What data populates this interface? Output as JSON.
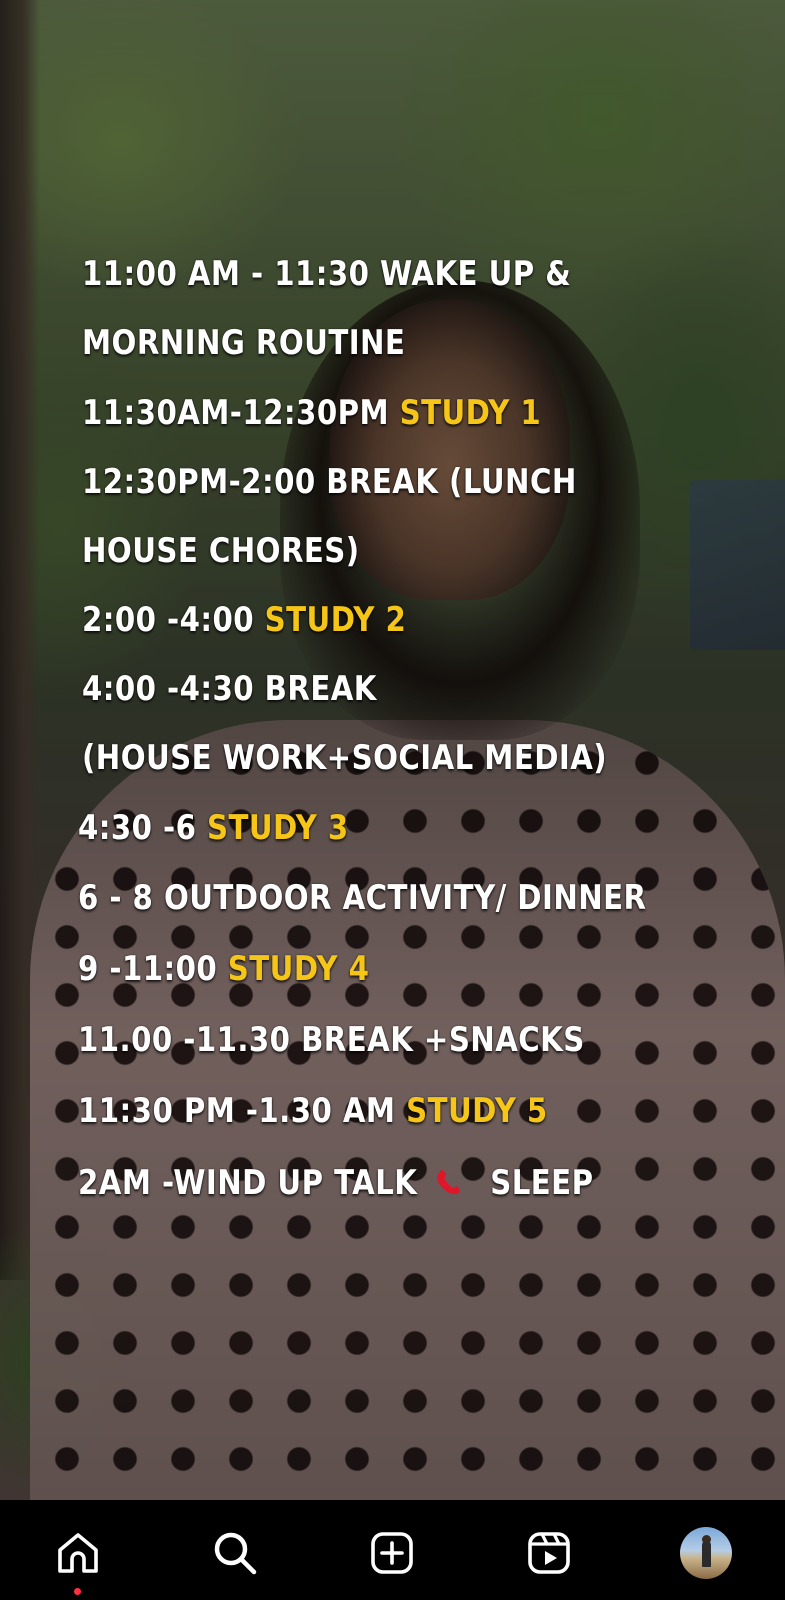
{
  "schedule": {
    "lines": [
      {
        "text": "11:00 AM - 11:30  WAKE UP &",
        "highlight": ""
      },
      {
        "text": "MORNING ROUTINE",
        "highlight": ""
      },
      {
        "text": "11:30AM-12:30PM ",
        "highlight": "STUDY 1"
      },
      {
        "text": "12:30PM-2:00 BREAK (LUNCH",
        "highlight": ""
      },
      {
        "text": "HOUSE CHORES)",
        "highlight": ""
      },
      {
        "text": "2:00 -4:00  ",
        "highlight": "STUDY 2"
      },
      {
        "text": "4:00 -4:30  BREAK",
        "highlight": ""
      },
      {
        "text": "(HOUSE WORK+SOCIAL MEDIA)",
        "highlight": ""
      },
      {
        "text": "4:30 -6  ",
        "highlight": "STUDY 3"
      },
      {
        "text": "6 - 8  OUTDOOR ACTIVITY/ DINNER",
        "highlight": ""
      },
      {
        "text": "9 -11:00  ",
        "highlight": "STUDY 4"
      },
      {
        "text": "11.00 -11.30 BREAK +SNACKS",
        "highlight": ""
      },
      {
        "text": "11:30 PM -1.30 AM ",
        "highlight": "STUDY 5"
      },
      {
        "text_before": "2AM -WIND UP TALK",
        "emoji": "telephone-receiver-icon",
        "text_after": "SLEEP"
      }
    ]
  },
  "colors": {
    "text": "#ffffff",
    "highlight": "#f5c518",
    "nav_background": "#000000",
    "notification_dot": "#ff3040"
  },
  "bottom_nav": {
    "items": [
      {
        "name": "home",
        "icon": "home-icon",
        "active": true,
        "has_notification_dot": true
      },
      {
        "name": "search",
        "icon": "search-icon",
        "active": false
      },
      {
        "name": "create",
        "icon": "plus-square-icon",
        "active": false
      },
      {
        "name": "reels",
        "icon": "reels-icon",
        "active": false
      },
      {
        "name": "profile",
        "icon": "profile-avatar",
        "active": false
      }
    ]
  }
}
